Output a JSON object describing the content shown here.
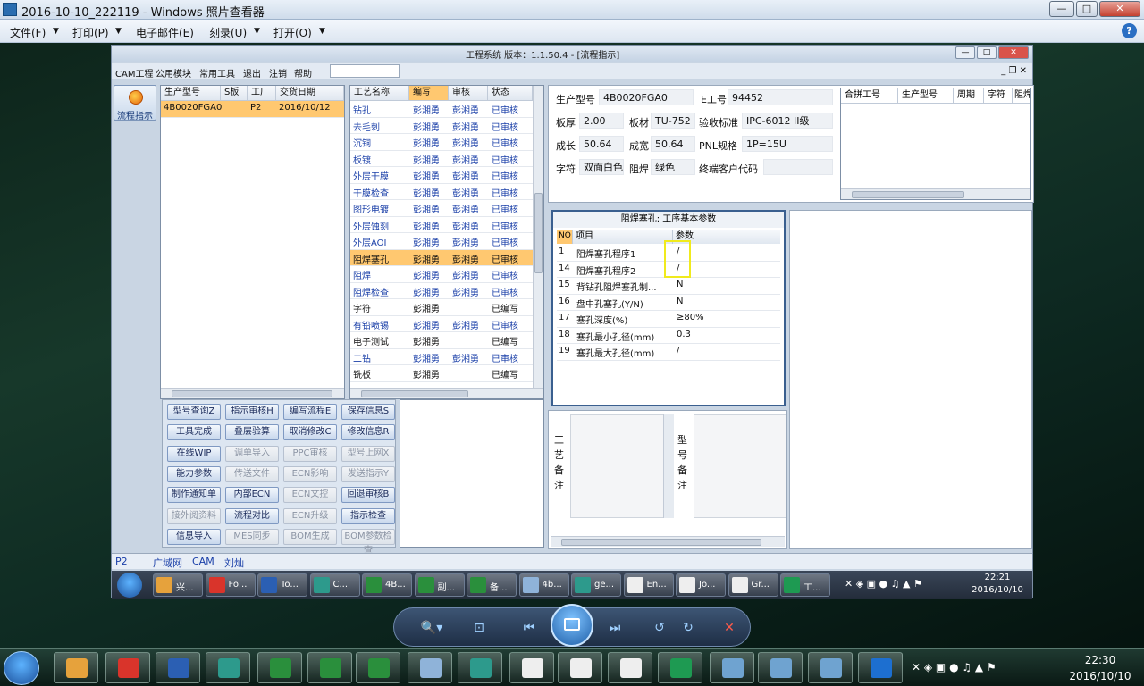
{
  "window": {
    "title": "2016-10-10_222119 - Windows 照片查看器",
    "min": "—",
    "max": "□",
    "close": "✕"
  },
  "menu": {
    "file": "文件(F)",
    "print": "打印(P)",
    "email": "电子邮件(E)",
    "burn": "刻录(U)",
    "open": "打开(O)",
    "help": "?"
  },
  "app": {
    "title": "工程系统  版本：1.1.50.4 - [流程指示]",
    "menu": [
      "CAM工程",
      "公用模块",
      "常用工具",
      "退出",
      "注销",
      "帮助"
    ],
    "mdi": "_ ❐ ✕",
    "flow_label": "流程指示",
    "order_grid": {
      "headers": [
        "生产型号",
        "S板",
        "工厂",
        "交货日期"
      ],
      "row": [
        "4B0020FGA0",
        "",
        "P2",
        "2016/10/12"
      ]
    },
    "process_grid": {
      "headers": [
        "工艺名称",
        "编写",
        "审核",
        "状态"
      ],
      "rows": [
        [
          "钻孔",
          "彭湘勇",
          "彭湘勇",
          "已审核"
        ],
        [
          "去毛刺",
          "彭湘勇",
          "彭湘勇",
          "已审核"
        ],
        [
          "沉铜",
          "彭湘勇",
          "彭湘勇",
          "已审核"
        ],
        [
          "板镀",
          "彭湘勇",
          "彭湘勇",
          "已审核"
        ],
        [
          "外层干膜",
          "彭湘勇",
          "彭湘勇",
          "已审核"
        ],
        [
          "干膜检查",
          "彭湘勇",
          "彭湘勇",
          "已审核"
        ],
        [
          "图形电镀",
          "彭湘勇",
          "彭湘勇",
          "已审核"
        ],
        [
          "外层蚀刻",
          "彭湘勇",
          "彭湘勇",
          "已审核"
        ],
        [
          "外层AOI",
          "彭湘勇",
          "彭湘勇",
          "已审核"
        ],
        [
          "阻焊塞孔",
          "彭湘勇",
          "彭湘勇",
          "已审核"
        ],
        [
          "阻焊",
          "彭湘勇",
          "彭湘勇",
          "已审核"
        ],
        [
          "阻焊检查",
          "彭湘勇",
          "彭湘勇",
          "已审核"
        ],
        [
          "字符",
          "彭湘勇",
          "",
          "已编写"
        ],
        [
          "有铅喷锡",
          "彭湘勇",
          "彭湘勇",
          "已审核"
        ],
        [
          "电子测试",
          "彭湘勇",
          "",
          "已编写"
        ],
        [
          "二钻",
          "彭湘勇",
          "彭湘勇",
          "已审核"
        ],
        [
          "铣板",
          "彭湘勇",
          "",
          "已编写"
        ]
      ]
    },
    "buttons": [
      [
        "型号查询Z",
        "指示审核H",
        "编写流程E",
        "保存信息S"
      ],
      [
        "工具完成",
        "叠层验算",
        "取消修改C",
        "修改信息R"
      ],
      [
        "在线WIP",
        "调单导入",
        "PPC审核",
        "型号上网X"
      ],
      [
        "能力参数",
        "传送文件",
        "ECN影响",
        "发送指示Y"
      ],
      [
        "制作通知单",
        "内部ECN",
        "ECN文控",
        "回退审核B"
      ],
      [
        "接外阅资料",
        "流程对比",
        "ECN升级",
        "指示检查"
      ],
      [
        "信息导入",
        "MES同步",
        "BOM生成",
        "BOM参数检查"
      ]
    ],
    "info": {
      "model_label": "生产型号",
      "model": "4B0020FGA0",
      "eng_label": "E工号",
      "eng": "94452",
      "thick_label": "板厚",
      "thick": "2.00",
      "material_label": "板材",
      "material": "TU-752",
      "std_label": "验收标准",
      "std": "IPC-6012 II级",
      "len_label": "成长",
      "len": "50.64",
      "wid_label": "成宽",
      "wid": "50.64",
      "pnl_label": "PNL规格",
      "pnl": "1P=15U",
      "char_label": "字符",
      "char": "双面白色",
      "mask_label": "阻焊",
      "mask": "绿色",
      "cust_label": "终端客户代码"
    },
    "merge_grid": {
      "headers": [
        "合拼工号",
        "生产型号",
        "周期",
        "字符",
        "阻焊"
      ]
    },
    "param": {
      "title": "阻焊塞孔: 工序基本参数",
      "headers": [
        "NO",
        "项目",
        "参数"
      ],
      "rows": [
        [
          "1",
          "阻焊塞孔程序1",
          "/"
        ],
        [
          "14",
          "阻焊塞孔程序2",
          "/"
        ],
        [
          "15",
          "背钻孔阻焊塞孔制...",
          "N"
        ],
        [
          "16",
          "盘中孔塞孔(Y/N)",
          "N"
        ],
        [
          "17",
          "塞孔深度(%)",
          "≥80%"
        ],
        [
          "18",
          "塞孔最小孔径(mm)",
          "0.3"
        ],
        [
          "19",
          "塞孔最大孔径(mm)",
          "/"
        ]
      ]
    },
    "notes": {
      "proc_label": "工艺备注",
      "model_label": "型号备注"
    },
    "status": {
      "factory": "P2",
      "net": "广域网",
      "dept": "CAM",
      "user": "刘灿"
    }
  },
  "inner_taskbar": {
    "items": [
      "兴...",
      "Fo...",
      "To...",
      "C...",
      "4B...",
      "副...",
      "备...",
      "4b...",
      "ge...",
      "En...",
      "Jo...",
      "Gr...",
      "工..."
    ],
    "time": "22:21",
    "date": "2016/10/10"
  },
  "taskbar": {
    "time": "22:30",
    "date": "2016/10/10"
  }
}
